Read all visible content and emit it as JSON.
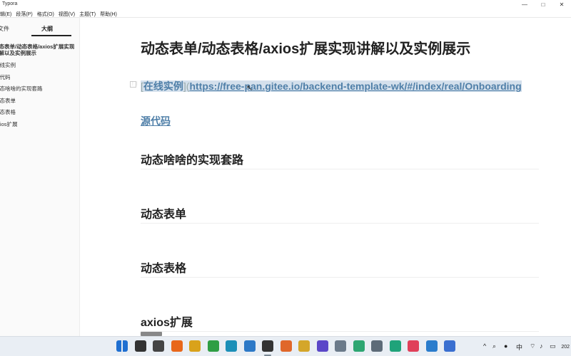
{
  "window": {
    "title": "Typora",
    "controls": [
      "—",
      "□",
      "✕"
    ]
  },
  "menu": [
    "编辑(E)",
    "段落(P)",
    "格式(O)",
    "视图(V)",
    "主题(T)",
    "帮助(H)"
  ],
  "sidebar": {
    "tabs": {
      "files": "文件",
      "outline": "大纲"
    },
    "outline_items": [
      {
        "label": "动态表单/动态表格/axios扩展实现讲解以及实例展示",
        "level": 1
      },
      {
        "label": "在线实例",
        "level": 2
      },
      {
        "label": "源代码",
        "level": 2
      },
      {
        "label": "动态啥啥的实现套路",
        "level": 2
      },
      {
        "label": "动态表单",
        "level": 2
      },
      {
        "label": "动态表格",
        "level": 2
      },
      {
        "label": "axios扩展",
        "level": 2
      }
    ],
    "footer": {
      "collapse": "‹",
      "source_mode": "</>"
    }
  },
  "document": {
    "title": "动态表单/动态表格/axios扩展实现讲解以及实例展示",
    "online_demo_text": "在线实例",
    "online_demo_url": "https://free-pan.gitee.io/backend-template-wk/#/index/real/Onboarding",
    "source_code_text": "源代码",
    "headings": [
      "动态啥啥的实现套路",
      "动态表单",
      "动态表格",
      "axios扩展"
    ]
  },
  "taskbar": {
    "apps": [
      {
        "name": "start-icon",
        "color": "#1f6fd1"
      },
      {
        "name": "search-icon",
        "color": "#333333"
      },
      {
        "name": "task-view-icon",
        "color": "#444444"
      },
      {
        "name": "firefox-icon",
        "color": "#e8671b"
      },
      {
        "name": "color-picker-icon",
        "color": "#d9a21b"
      },
      {
        "name": "chrome-icon",
        "color": "#2f9e44"
      },
      {
        "name": "edge-icon",
        "color": "#1b8fb8"
      },
      {
        "name": "calendar-app-icon",
        "color": "#2d79c7"
      },
      {
        "name": "typora-icon",
        "color": "#333333"
      },
      {
        "name": "magnifier-app-icon",
        "color": "#e0672a"
      },
      {
        "name": "file-manager-icon",
        "color": "#d4a62a"
      },
      {
        "name": "vpn-icon",
        "color": "#5b47c8"
      },
      {
        "name": "database-icon",
        "color": "#6b7a8a"
      },
      {
        "name": "dev-tool-icon",
        "color": "#2da672"
      },
      {
        "name": "settings-icon",
        "color": "#5d6b78"
      },
      {
        "name": "notes-app-icon",
        "color": "#1fa37a"
      },
      {
        "name": "pocket-icon",
        "color": "#e0405a"
      },
      {
        "name": "vscode-icon",
        "color": "#2a7ccc"
      },
      {
        "name": "translator-icon",
        "color": "#3a6fd0"
      }
    ],
    "tray": {
      "chevron": "^",
      "input_method": "中",
      "clock": "202"
    }
  }
}
